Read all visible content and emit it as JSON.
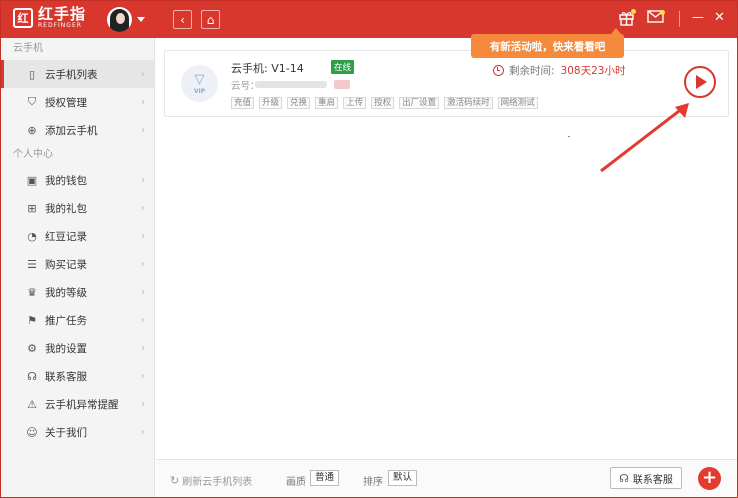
{
  "app": {
    "logo_mark": "红",
    "logo_cn": "红手指",
    "logo_en": "REDFINGER"
  },
  "titlebar": {
    "back_icon": "‹",
    "home_icon": "⌂",
    "gift_icon": "🎁",
    "mail_icon": "✉",
    "minimize_icon": "—",
    "close_icon": "✕"
  },
  "sidebar": {
    "section_phone": "云手机",
    "phone_items": [
      {
        "label": "云手机列表",
        "icon": "phone-icon",
        "glyph": "▯",
        "active": true
      },
      {
        "label": "授权管理",
        "icon": "shield-icon",
        "glyph": "⛉"
      },
      {
        "label": "添加云手机",
        "icon": "plus-circle-icon",
        "glyph": "⊕"
      }
    ],
    "section_personal": "个人中心",
    "personal_items": [
      {
        "label": "我的钱包",
        "icon": "wallet-icon",
        "glyph": "▣"
      },
      {
        "label": "我的礼包",
        "icon": "gift-icon",
        "glyph": "⊞"
      },
      {
        "label": "红豆记录",
        "icon": "bean-icon",
        "glyph": "◔"
      },
      {
        "label": "购买记录",
        "icon": "record-icon",
        "glyph": "☰"
      },
      {
        "label": "我的等级",
        "icon": "crown-icon",
        "glyph": "♛"
      },
      {
        "label": "推广任务",
        "icon": "flag-icon",
        "glyph": "⚑"
      },
      {
        "label": "我的设置",
        "icon": "gear-icon",
        "glyph": "⚙"
      },
      {
        "label": "联系客服",
        "icon": "headset-icon",
        "glyph": "☊"
      },
      {
        "label": "云手机异常提醒",
        "icon": "warning-icon",
        "glyph": "⚠"
      },
      {
        "label": "关于我们",
        "icon": "smile-icon",
        "glyph": "☺"
      }
    ],
    "arrow": "›"
  },
  "card": {
    "vip_gem": "▽",
    "vip_text": "VIP",
    "name": "云手机: V1-14",
    "status": "在线",
    "cloud_id_label": "云号：",
    "remain_label": "剩余时间:",
    "remain_value": "308天23小时",
    "actions": [
      "充值",
      "升级",
      "兑换",
      "重启",
      "上传",
      "授权",
      "出厂设置",
      "激活码续时",
      "网络测试"
    ]
  },
  "promo": {
    "text": "有新活动啦，快来看看吧"
  },
  "footer": {
    "refresh_icon": "↻",
    "refresh_label": "刷新云手机列表",
    "quality_label": "画质",
    "quality_value": "普通",
    "sort_label": "排序",
    "sort_value": "默认",
    "contact_icon": "☊",
    "contact_label": "联系客服",
    "add_label": "+"
  },
  "colors": {
    "brand_red": "#d7372d",
    "online_green": "#2e9e47",
    "promo_orange": "#f58a3c"
  }
}
